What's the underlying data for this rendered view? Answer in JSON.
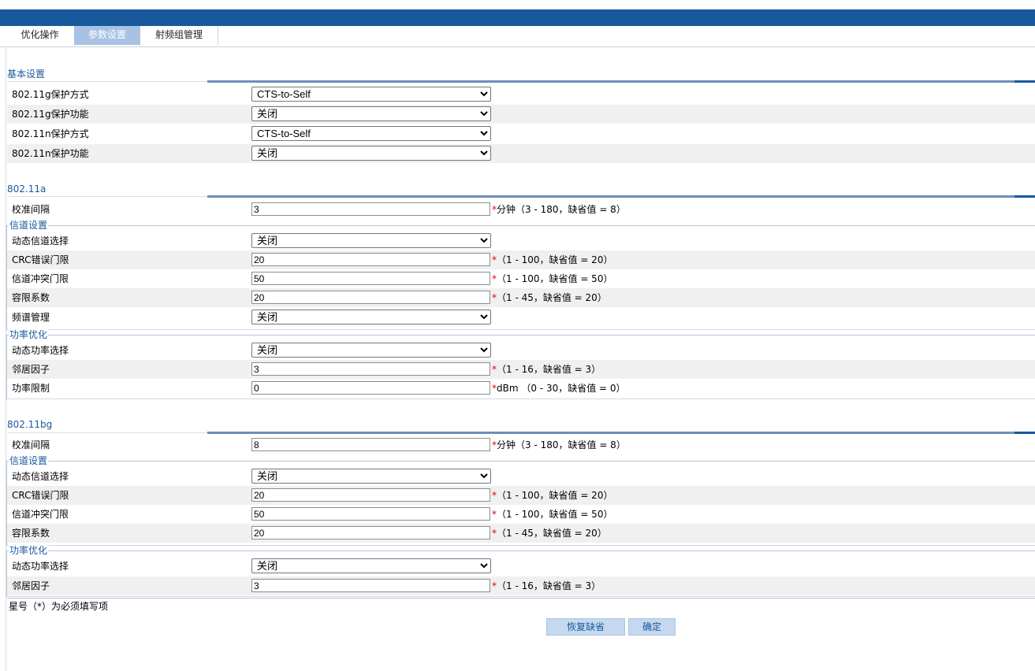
{
  "tabs": [
    {
      "label": "优化操作"
    },
    {
      "label": "参数设置"
    },
    {
      "label": "射频组管理"
    }
  ],
  "basic": {
    "title": "基本设置",
    "rows": [
      {
        "label": "802.11g保护方式",
        "value": "CTS-to-Self"
      },
      {
        "label": "802.11g保护功能",
        "value": "关闭"
      },
      {
        "label": "802.11n保护方式",
        "value": "CTS-to-Self"
      },
      {
        "label": "802.11n保护功能",
        "value": "关闭"
      }
    ]
  },
  "a": {
    "title": "802.11a",
    "calib": {
      "label": "校准间隔",
      "value": "3",
      "hint": "分钟（3 - 180，缺省值 = 8）"
    },
    "channel": {
      "legend": "信道设置",
      "dynamic": {
        "label": "动态信道选择",
        "value": "关闭"
      },
      "crc": {
        "label": "CRC错误门限",
        "value": "20",
        "hint": "（1 - 100，缺省值 = 20）"
      },
      "conflict": {
        "label": "信道冲突门限",
        "value": "50",
        "hint": "（1 - 100，缺省值 = 50）"
      },
      "tolerance": {
        "label": "容限系数",
        "value": "20",
        "hint": "（1 - 45，缺省值 = 20）"
      },
      "spectrum": {
        "label": "频谱管理",
        "value": "关闭"
      }
    },
    "power": {
      "legend": "功率优化",
      "dynamic": {
        "label": "动态功率选择",
        "value": "关闭"
      },
      "neighbor": {
        "label": "邻居因子",
        "value": "3",
        "hint": "（1 - 16，缺省值 = 3）"
      },
      "limit": {
        "label": "功率限制",
        "value": "0",
        "hint": "dBm （0 - 30，缺省值 = 0）"
      }
    }
  },
  "bg": {
    "title": "802.11bg",
    "calib": {
      "label": "校准间隔",
      "value": "8",
      "hint": "分钟（3 - 180，缺省值 = 8）"
    },
    "channel": {
      "legend": "信道设置",
      "dynamic": {
        "label": "动态信道选择",
        "value": "关闭"
      },
      "crc": {
        "label": "CRC错误门限",
        "value": "20",
        "hint": "（1 - 100，缺省值 = 20）"
      },
      "conflict": {
        "label": "信道冲突门限",
        "value": "50",
        "hint": "（1 - 100，缺省值 = 50）"
      },
      "tolerance": {
        "label": "容限系数",
        "value": "20",
        "hint": "（1 - 45，缺省值 = 20）"
      }
    },
    "power": {
      "legend": "功率优化",
      "dynamic": {
        "label": "动态功率选择",
        "value": "关闭"
      },
      "neighbor": {
        "label": "邻居因子",
        "value": "3",
        "hint": "（1 - 16，缺省值 = 3）"
      }
    }
  },
  "star": "*",
  "required_note": "星号（*）为必须填写项",
  "buttons": {
    "restore": "恢复缺省",
    "confirm": "确定"
  },
  "colors": {
    "header": "#17599b",
    "active_tab": "#a8c2e4",
    "required": "#e00000",
    "button": "#c5d8ef"
  }
}
